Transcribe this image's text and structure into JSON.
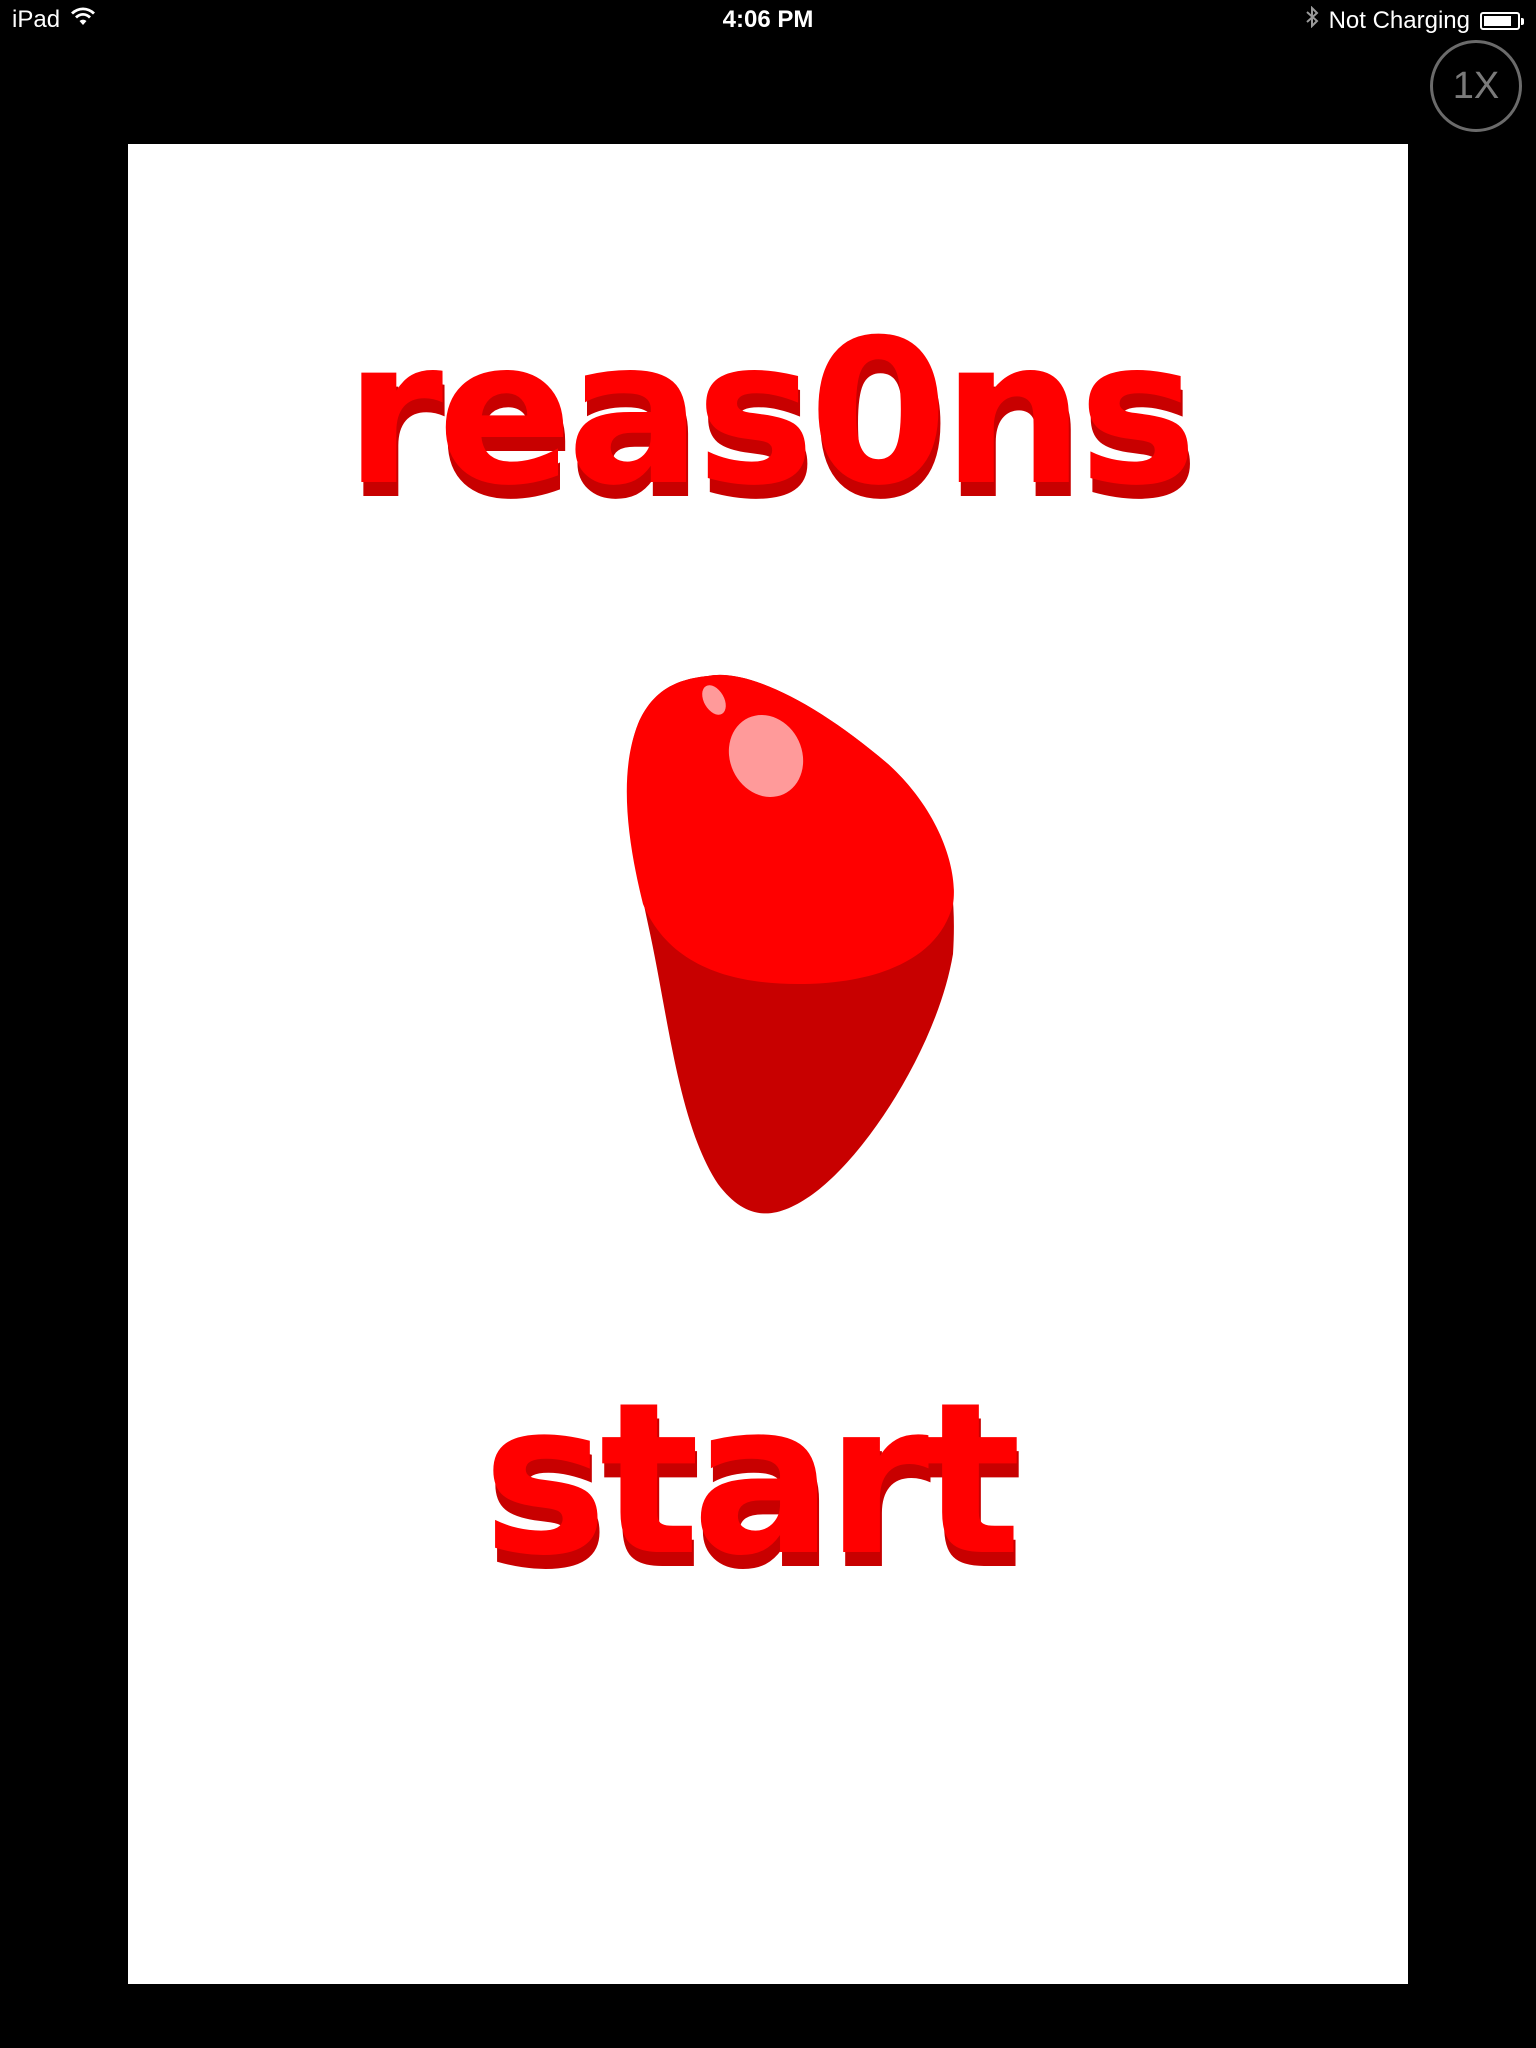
{
  "status_bar": {
    "device": "iPad",
    "time": "4:06 PM",
    "charging": "Not Charging",
    "battery_level": 0.85
  },
  "zoom_button": {
    "label": "1X"
  },
  "game": {
    "title": "reas0ns",
    "start_label": "start",
    "accent_color": "#ff0000",
    "shadow_color": "#c80000",
    "highlight_color": "#ff9a9a"
  }
}
